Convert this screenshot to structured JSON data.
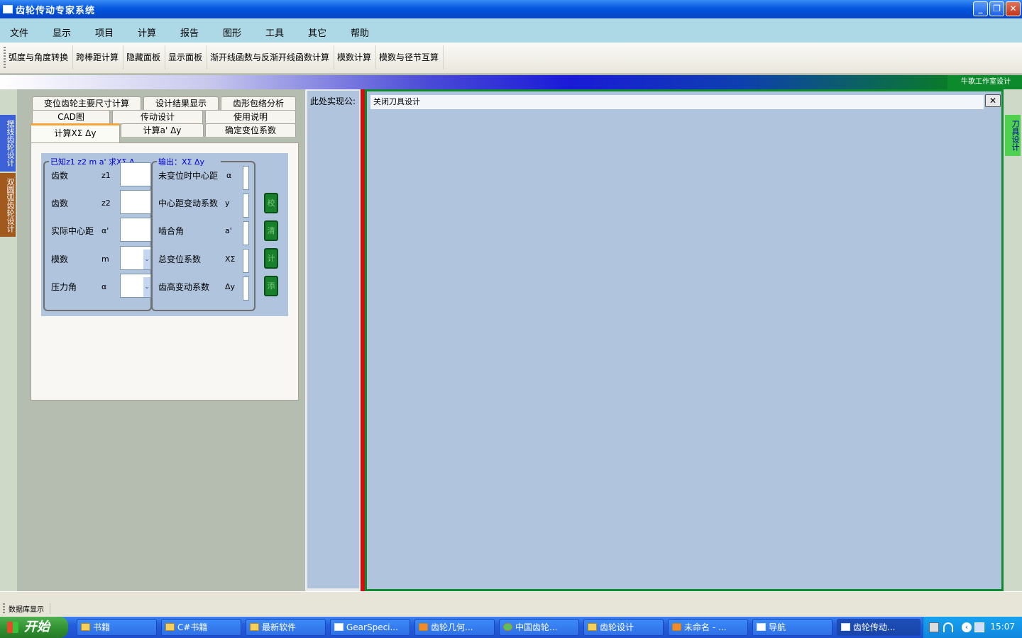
{
  "window": {
    "title": "齿轮传动专家系统"
  },
  "menu": [
    "文件",
    "显示",
    "项目",
    "计算",
    "报告",
    "图形",
    "工具",
    "其它",
    "帮助"
  ],
  "toolbar": [
    "弧度与角度转换",
    "跨棒距计算",
    "隐藏面板",
    "显示面板",
    "渐开线函数与反渐开线函数计算",
    "模数计算",
    "模数与径节互算"
  ],
  "banner": {
    "label": "牛歌工作室设计"
  },
  "left_tabs": [
    "摆线齿轮设计",
    "双圆弧齿轮设计"
  ],
  "right_tab": "刀具设计",
  "tabs": {
    "row1": [
      "变位齿轮主要尺寸计算",
      "设计结果显示",
      "齿形包络分析"
    ],
    "row2": [
      "CAD图",
      "传动设计",
      "使用说明"
    ],
    "row3": [
      "计算XΣ Δy",
      "计算a' Δy",
      "确定变位系数"
    ],
    "active": "计算XΣ Δy"
  },
  "input_group": {
    "title": "已知z1 z2 m a' 求XΣ Δ",
    "rows": [
      {
        "label": "齿数",
        "symbol": "z1",
        "value": ""
      },
      {
        "label": "齿数",
        "symbol": "z2",
        "value": ""
      },
      {
        "label": "实际中心距",
        "symbol": "α'",
        "value": ""
      },
      {
        "label": "模数",
        "symbol": "m",
        "value": ""
      },
      {
        "label": "压力角",
        "symbol": "α",
        "value": ""
      }
    ]
  },
  "output_group": {
    "title": "输出：XΣ Δy",
    "rows": [
      {
        "label": "未变位时中心距",
        "symbol": "α",
        "value": ""
      },
      {
        "label": "中心距变动系数",
        "symbol": "y",
        "value": ""
      },
      {
        "label": "啮合角",
        "symbol": "a'",
        "value": ""
      },
      {
        "label": "总变位系数",
        "symbol": "XΣ",
        "value": ""
      },
      {
        "label": "齿高变动系数",
        "symbol": "Δy",
        "value": ""
      }
    ]
  },
  "side_buttons": [
    "校",
    "清",
    "计",
    "添"
  ],
  "mid_panel": {
    "text": "此处实现公:"
  },
  "main_panel": {
    "header": "关闭刀具设计",
    "close": "✕"
  },
  "status": {
    "text": "数据库显示"
  },
  "taskbar": {
    "start": "开始",
    "items": [
      "书籍",
      "C#书籍",
      "最新软件",
      "GearSpeci...",
      "齿轮几何...",
      "中国齿轮...",
      "齿轮设计",
      "未命名 - ...",
      "导航",
      "齿轮传动..."
    ],
    "clock": "15:07"
  },
  "colors": {
    "titlebar": "#0a5ce0",
    "menubar": "#add8e6",
    "panel": "#b0c4de",
    "accent_green": "#0c8a2c",
    "accent_red": "#d01010"
  }
}
